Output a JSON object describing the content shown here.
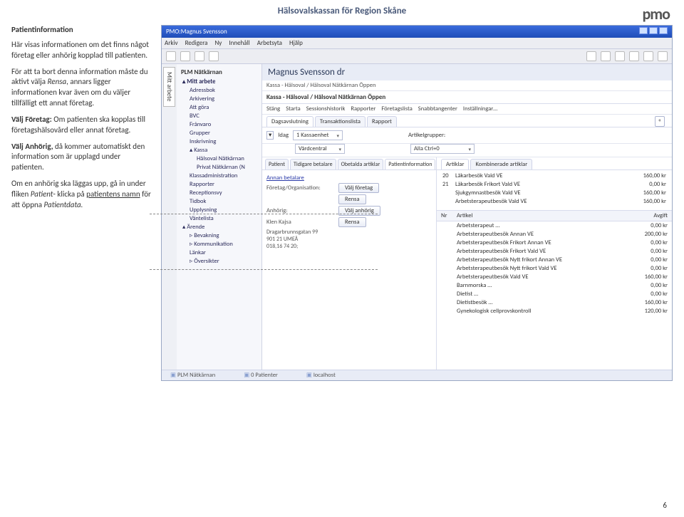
{
  "page": {
    "header": "Hälsovalskassan för Region Skåne",
    "logo": "pmo",
    "number": "6"
  },
  "left": {
    "title": "Patientinformation",
    "p1": "Här visas informationen om det finns något företag eller anhörig kopplad till patienten.",
    "p2_a": "För att ta bort denna information måste du aktivt välja ",
    "p2_em": "Rensa",
    "p2_b": ", annars ligger informationen kvar även om du väljer tillfälligt ett annat företag.",
    "p3_a": "Välj Företag: ",
    "p3_b": "Om patienten ska kopplas till företagshälsovård eller annat företag.",
    "p4_a": "Välj Anhörig, ",
    "p4_b": "då kommer automatiskt den information som är upplagd under patienten.",
    "p5_a": "Om en anhörig ska läggas upp, gå in under fliken ",
    "p5_em": "Patient",
    "p5_b": "- klicka på ",
    "p5_u": "patientens namn",
    "p5_c": " för att öppna ",
    "p5_em2": "Patientdata."
  },
  "app": {
    "winTitle": "PMO:Magnus Svensson",
    "menus": [
      "Arkiv",
      "Redigera",
      "Ny",
      "Innehåll",
      "Arbetsyta",
      "Hjälp"
    ],
    "sideTab": "Mitt arbete",
    "treeTitle": "PLM Nätkärnan",
    "tree": {
      "root": "Mitt arbete",
      "items": [
        "Adressbok",
        "Arkivering",
        "Att göra",
        "BVC",
        "Frånvaro",
        "Grupper",
        "Inskrivning"
      ],
      "kassa": "Kassa",
      "kassaSub": [
        "Hälsoval Nätkärnan",
        "Privat Nätkärnan (N"
      ],
      "rest": [
        "Klassadministration",
        "Rapporter",
        "Receptionsvy",
        "Tidbok",
        "Upplysning",
        "Väntelista"
      ],
      "arende": "Ärende",
      "arendeSub": [
        "Bevakning",
        "Kommunikation",
        "Länkar",
        "Översikter"
      ]
    },
    "patientHeader": "Magnus Svensson  dr",
    "crumb": "Kassa - Hälsoval / Hälsoval Nätkärnan Öppen",
    "crumb2": "Kassa - Hälsoval / Hälsoval Nätkärnan Öppen",
    "subToolbar": [
      "Stäng",
      "Starta",
      "Sessionshistorik",
      "Rapporter",
      "Företagslista",
      "Snabbtangenter",
      "Inställningar…"
    ],
    "subTabs": [
      "Dagsavslutning",
      "Transaktionslista",
      "Rapport"
    ],
    "filter": {
      "label1": "Idag",
      "v1": "1 Kassaenhet",
      "v2": "Vårdcentral",
      "label2": "Artikelgrupper:",
      "v3": "Alla Ctrl+0"
    },
    "ptTabs": [
      "Patient",
      "Tidigare betalare",
      "Obetalda artiklar",
      "Patientinformation"
    ],
    "form": {
      "annanBetalare": "Annan betalare",
      "foretagLbl": "Företag/Organisation:",
      "valjForetag": "Välj företag",
      "rensa": "Rensa",
      "anhorigLbl": "Anhörig:",
      "anhorigName": "Klen Kajsa",
      "addr1": "Dragarbrunnsgatan 99",
      "addr2": "901 21  UMEÅ",
      "addr3": "018,16 74 20;",
      "valjAnhorig": "Välj anhörig"
    },
    "artTabs": [
      "Artiklar",
      "Kombinerade artiklar"
    ],
    "summary": [
      {
        "n": "20",
        "label": "Läkarbesök Vald VE",
        "val": "160,00 kr"
      },
      {
        "n": "21",
        "label": "Läkarbesök Frikort Vald VE",
        "val": "0,00 kr"
      },
      {
        "n": "",
        "label": "Sjukgymnastbesök Vald VE",
        "val": "160,00 kr"
      },
      {
        "n": "",
        "label": "Arbetsterapeutbesök Vald VE",
        "val": "160,00 kr"
      }
    ],
    "tableHead": {
      "c1": "Nr",
      "c2": "Artikel",
      "c3": "Avgift"
    },
    "tableRows": [
      {
        "c1": "",
        "c2": "Arbetsterapeut …",
        "c3": "0,00 kr"
      },
      {
        "c1": "",
        "c2": "Arbetsterapeutbesök Annan VE",
        "c3": "200,00 kr"
      },
      {
        "c1": "",
        "c2": "Arbetsterapeutbesök Frikort Annan VE",
        "c3": "0,00 kr"
      },
      {
        "c1": "",
        "c2": "Arbetsterapeutbesök Frikort Vald VE",
        "c3": "0,00 kr"
      },
      {
        "c1": "",
        "c2": "Arbetsterapeutbesök Nytt frikort Annan VE",
        "c3": "0,00 kr"
      },
      {
        "c1": "",
        "c2": "Arbetsterapeutbesök Nytt frikort Vald VE",
        "c3": "0,00 kr"
      },
      {
        "c1": "",
        "c2": "Arbetsterapeutbesök Vald VE",
        "c3": "160,00 kr"
      },
      {
        "c1": "",
        "c2": "Barnmorska …",
        "c3": "0,00 kr"
      },
      {
        "c1": "",
        "c2": "Dietist …",
        "c3": "0,00 kr"
      },
      {
        "c1": "",
        "c2": "Dietistbesök …",
        "c3": "160,00 kr"
      },
      {
        "c1": "",
        "c2": "Gynekologisk cellprovskontroll",
        "c3": "120,00 kr"
      }
    ],
    "status": [
      "PLM Nätkärnan",
      "0 Patienter",
      "localhost"
    ]
  }
}
